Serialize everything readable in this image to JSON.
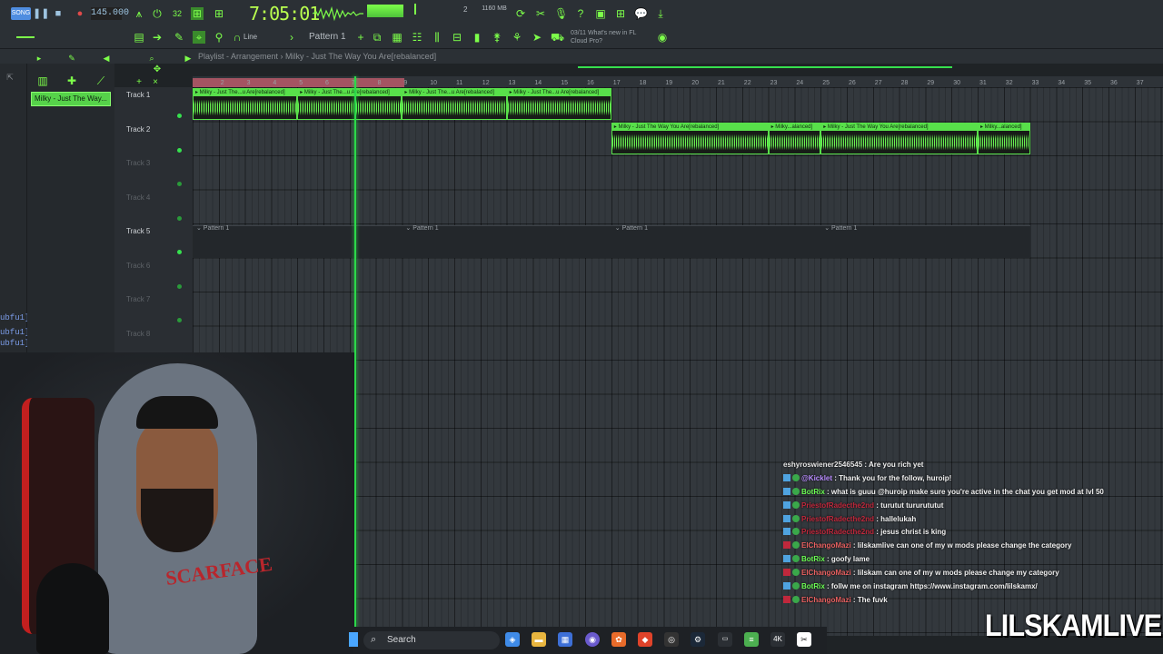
{
  "toolbar": {
    "song_mode": "SONG",
    "bpm": "145.000",
    "time": "7:05:01",
    "cpu_value": "2",
    "memory": "1160 MB",
    "pattern_selector": "Pattern 1",
    "snap": "Line",
    "news_date": "03/11",
    "news_text": "What's new in FL Cloud Pro?"
  },
  "playlist": {
    "breadcrumb": "Playlist - Arrangement › Milky - Just The Way You Are[rebalanced]",
    "picker_item": "Milky - Just The Way...",
    "ruler_numbers": [
      "1",
      "2",
      "3",
      "4",
      "5",
      "6",
      "7",
      "8",
      "9",
      "10",
      "11",
      "12",
      "13",
      "14",
      "15",
      "16",
      "17",
      "18",
      "19",
      "20",
      "21",
      "22",
      "23",
      "24",
      "25",
      "26",
      "27",
      "28",
      "29",
      "30",
      "31",
      "32",
      "33",
      "34",
      "35",
      "36",
      "37"
    ],
    "tracks": [
      {
        "name": "Track 1",
        "active": true
      },
      {
        "name": "Track 2",
        "active": true
      },
      {
        "name": "Track 3",
        "active": false
      },
      {
        "name": "Track 4",
        "active": false
      },
      {
        "name": "Track 5",
        "active": true
      },
      {
        "name": "Track 6",
        "active": false
      },
      {
        "name": "Track 7",
        "active": false
      },
      {
        "name": "Track 8",
        "active": false
      }
    ],
    "track1_clip_labels": [
      "Milky - Just The...u Are[rebalanced]",
      "Milky - Just The...u Are[rebalanced]",
      "Milky - Just The...u Are[rebalanced]",
      "Milky - Just The...u Are[rebalanced]",
      "Milky - Just The...u Are[rebalanced]",
      "Milky - Just The...u Are[rebalanced]",
      "Milky - Just The...u Are[rebalanced]",
      "Milky - Just The...u Are[rebalanced]"
    ],
    "track2_clip_labels": [
      "Milky - Just The Way You Are[rebalanced]",
      "Milky...alanced]",
      "Milky - Just The Way You Are[rebalanced]",
      "Milky...alanced]"
    ],
    "pattern_labels": [
      "Pattern 1",
      "Pattern 1",
      "Pattern 1",
      "Pattern 1"
    ]
  },
  "side_text": [
    "ubfu1]",
    "ubfu1]",
    "ubfu1]"
  ],
  "chat": [
    {
      "user": "eshyroswiener2546545",
      "msg": "Are you rich yet",
      "color": "#e6e6e6",
      "badge": ""
    },
    {
      "user": "@Kicklet",
      "msg": "Thank you for the follow, huroip!",
      "color": "#b98cff",
      "badge": "#4fa3e0"
    },
    {
      "user": "BotRix",
      "msg": "what is guuu @huroip make sure you're active in the chat you get mod at lvl 50",
      "color": "#6dff55",
      "badge": "#4fa3e0"
    },
    {
      "user": "PriestofRadecthe2nd",
      "msg": "turutut tururututut",
      "color": "#c0283c",
      "badge": "#4fa3e0"
    },
    {
      "user": "PriestofRadecthe2nd",
      "msg": "hallelukah",
      "color": "#c0283c",
      "badge": "#4fa3e0"
    },
    {
      "user": "PriestofRadecthe2nd",
      "msg": "jesus christ is king",
      "color": "#c0283c",
      "badge": "#4fa3e0"
    },
    {
      "user": "ElChangoMazi",
      "msg": "lilskamlive can one of my w mods please change the category",
      "color": "#e86060",
      "badge": "#c0283c"
    },
    {
      "user": "BotRix",
      "msg": "goofy lame",
      "color": "#6dff55",
      "badge": "#4fa3e0"
    },
    {
      "user": "ElChangoMazi",
      "msg": "lilskam can one of my w mods please change my category",
      "color": "#e86060",
      "badge": "#c0283c"
    },
    {
      "user": "BotRix",
      "msg": "follw me on instagram https://www.instagram.com/lilskamx/",
      "color": "#6dff55",
      "badge": "#4fa3e0"
    },
    {
      "user": "ElChangoMazi",
      "msg": "The fuvk",
      "color": "#e86060",
      "badge": "#c0283c"
    }
  ],
  "taskbar": {
    "search_label": "Search"
  },
  "webcam": {
    "hoodie_text": "SCARFACE"
  },
  "watermark": "LILSKAMLIVE",
  "colors": {
    "accent_green": "#58e04a",
    "playhead": "#2cd94a",
    "loop": "#b85a6a"
  }
}
